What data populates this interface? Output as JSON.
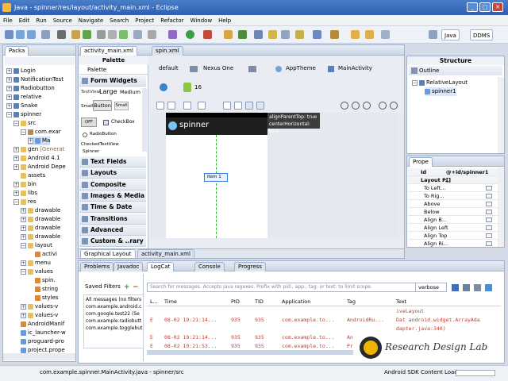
{
  "window": {
    "title": "Java - spinner/res/layout/activity_main.xml - Eclipse",
    "minimize": "_",
    "maximize": "□",
    "close": "✕"
  },
  "menu": [
    "File",
    "Edit",
    "Run",
    "Source",
    "Navigate",
    "Search",
    "Project",
    "Refactor",
    "Window",
    "Help"
  ],
  "perspectives": {
    "java": "Java",
    "ddms": "DDMS"
  },
  "package_explorer": {
    "tab": "Packa",
    "rows": [
      {
        "label": "Login",
        "twisty": "+",
        "icon": "proj"
      },
      {
        "label": "NotificationTest",
        "twisty": "+",
        "icon": "proj"
      },
      {
        "label": "Radiobutton",
        "twisty": "+",
        "icon": "proj"
      },
      {
        "label": "relative",
        "twisty": "+",
        "icon": "proj"
      },
      {
        "label": "Snake",
        "twisty": "+",
        "icon": "proj"
      },
      {
        "label": "spinner",
        "twisty": "−",
        "icon": "proj"
      },
      {
        "label": "src",
        "twisty": "−",
        "icon": "folder"
      },
      {
        "label": "com.exar",
        "twisty": "−",
        "icon": "pkg"
      },
      {
        "label": "Ma",
        "twisty": "+",
        "icon": "jfile"
      },
      {
        "label": "gen",
        "suffix": "[Generat",
        "twisty": "+",
        "icon": "folder"
      },
      {
        "label": "Android 4.1",
        "twisty": "+",
        "icon": "folder"
      },
      {
        "label": "Android Depe",
        "twisty": "+",
        "icon": "folder"
      },
      {
        "label": "assets",
        "twisty": "",
        "icon": "folder"
      },
      {
        "label": "bin",
        "twisty": "+",
        "icon": "folder"
      },
      {
        "label": "libs",
        "twisty": "+",
        "icon": "folder"
      },
      {
        "label": "res",
        "twisty": "−",
        "icon": "folder"
      },
      {
        "label": "drawable",
        "twisty": "+",
        "icon": "folder"
      },
      {
        "label": "drawable",
        "twisty": "+",
        "icon": "folder"
      },
      {
        "label": "drawable",
        "twisty": "+",
        "icon": "folder"
      },
      {
        "label": "drawable",
        "twisty": "+",
        "icon": "folder"
      },
      {
        "label": "layout",
        "twisty": "−",
        "icon": "folder"
      },
      {
        "label": "activi",
        "twisty": "",
        "icon": "xml"
      },
      {
        "label": "menu",
        "twisty": "+",
        "icon": "folder"
      },
      {
        "label": "values",
        "twisty": "−",
        "icon": "folder"
      },
      {
        "label": "spin.",
        "twisty": "",
        "icon": "xml"
      },
      {
        "label": "string",
        "twisty": "",
        "icon": "xml"
      },
      {
        "label": "styles",
        "twisty": "",
        "icon": "xml"
      },
      {
        "label": "values-v",
        "twisty": "+",
        "icon": "folder"
      },
      {
        "label": "values-v",
        "twisty": "+",
        "icon": "folder"
      },
      {
        "label": "AndroidManif",
        "twisty": "",
        "icon": "xml"
      },
      {
        "label": "ic_launcher-w",
        "twisty": "",
        "icon": "jfile"
      },
      {
        "label": "proguard-pro",
        "twisty": "",
        "icon": "jfile"
      },
      {
        "label": "project.prope",
        "twisty": "",
        "icon": "jfile"
      }
    ]
  },
  "editor": {
    "tabs": [
      "activity_main.xml",
      "spin.xml"
    ],
    "palette": {
      "title": "Palette",
      "header": "Palette",
      "form_widgets": "Form Widgets",
      "textview_label": "TextView",
      "large": "Large",
      "medium": "Medium",
      "small": "Small",
      "button": "Button",
      "small_button": "Small",
      "toggle": "OFF",
      "checkbox": "CheckBox",
      "radiobutton": "RadioButton",
      "checkedtextview": "CheckedTextView",
      "spinner": "Spinner",
      "categories": [
        "Text Fields",
        "Layouts",
        "Composite",
        "Images & Media",
        "Time & Date",
        "Transitions",
        "Advanced",
        "Custom & ..rary Views"
      ]
    },
    "config_bar": {
      "theme_default": "default",
      "device": "Nexus One",
      "app_theme": "AppTheme",
      "activity": "MainActivity",
      "api_level": "16"
    },
    "device_preview": {
      "app_title": "spinner",
      "widget_label": "Item 1",
      "tooltip_line1": "alignParentTop: true",
      "tooltip_line2": "centerHorizontal: true"
    },
    "bottom_tabs": [
      "Graphical Layout",
      "activity_main.xml"
    ]
  },
  "structure": {
    "title": "Structure",
    "outline_label": "Outline",
    "tree": [
      "RelativeLayout",
      "spinner1"
    ],
    "properties_tab": "Prope",
    "properties": [
      {
        "key": "Id",
        "value": "@+id/spinner1",
        "bold": true
      },
      {
        "key": "Layout P...",
        "value": "[]",
        "bold": true
      },
      {
        "key": "To Left...",
        "value": ""
      },
      {
        "key": "To Rig...",
        "value": ""
      },
      {
        "key": "Above",
        "value": ""
      },
      {
        "key": "Below",
        "value": ""
      },
      {
        "key": "Align B...",
        "value": ""
      },
      {
        "key": "Align Left",
        "value": ""
      },
      {
        "key": "Align Top",
        "value": ""
      },
      {
        "key": "Align Ri...",
        "value": ""
      }
    ]
  },
  "bottom": {
    "tabs": [
      "Problems",
      "Javadoc",
      "LogCat",
      "Console",
      "Progress"
    ],
    "saved_filters": "Saved Filters",
    "filters": [
      "All messages (no filters",
      "com.example.android.c",
      "com.google.test22 (Se",
      "com.example.radiobutt",
      "com.example.togglebut"
    ],
    "search_placeholder": "Search for messages. Accepts Java regexes. Prefix with pid:, app:, tag: or text: to limit scope.",
    "level": "verbose",
    "columns": [
      "L...",
      "Time",
      "PID",
      "TID",
      "Application",
      "Tag",
      "Text"
    ],
    "rows": [
      {
        "l": "",
        "time": "",
        "pid": "",
        "tid": "",
        "app": "",
        "tag": "",
        "text": "iveLayout"
      },
      {
        "l": "E",
        "time": "08-02 19:21:14...",
        "pid": "935",
        "tid": "935",
        "app": "com.example.to...",
        "tag": "AndroidRu...",
        "text": "Dat android.widget.ArrayAda"
      },
      {
        "l": "",
        "time": "",
        "pid": "",
        "tid": "",
        "app": "",
        "tag": "",
        "text": "dapter.java:340)"
      },
      {
        "l": "E",
        "time": "08-02 19:21:14...",
        "pid": "935",
        "tid": "935",
        "app": "com.example.to...",
        "tag": "An",
        "text": ""
      },
      {
        "l": "E",
        "time": "08-02 19:21:53...",
        "pid": "935",
        "tid": "935",
        "app": "com.example.to...",
        "tag": "Pr",
        "text": ""
      }
    ]
  },
  "watermark": "Research Design Lab",
  "status_bar": {
    "left": "com.example.spinner.MainActivity.java - spinner/src",
    "right": "Android SDK Content Loader"
  },
  "colors": {
    "titlebar": "#2f5fae",
    "device_header": "#1f1f1f",
    "selection_guide": "#2bb52b",
    "logcat_error": "#c43b2f"
  }
}
